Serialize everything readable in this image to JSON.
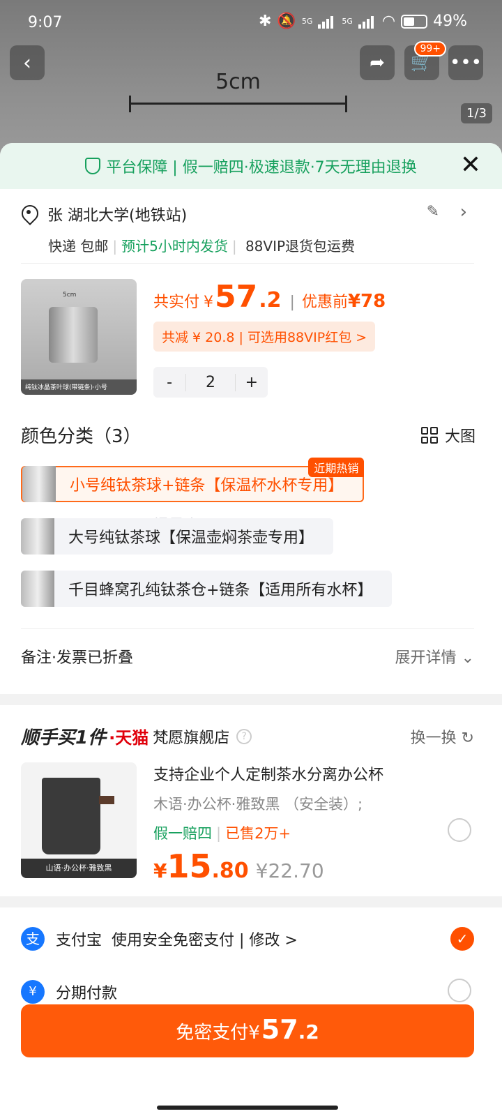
{
  "status": {
    "time": "9:07",
    "net1": "5G",
    "net2": "5G",
    "battery": "49%"
  },
  "header": {
    "cart_badge": "99+",
    "pager": "1/3",
    "measure_label": "5cm"
  },
  "guarantee": {
    "text": "平台保障 | 假一赔四·极速退款·7天无理由退换"
  },
  "address": {
    "name_addr": "张 湖北大学(地铁站)",
    "delivery": "快递 包邮",
    "ship_eta": "预计5小时内发货",
    "vip_return": "88VIP退货包运费"
  },
  "product": {
    "thumb_dim": "5cm",
    "thumb_caption": "纯钛冰晶茶叶球(带链条)·小号",
    "price_prefix": "共实付",
    "currency": "¥",
    "price_int": "57",
    "price_dec": ".2",
    "before_label": "优惠前",
    "before_price": "¥78",
    "saving": "共减 ¥ 20.8 | 可选用88VIP红包 >",
    "qty_minus": "-",
    "qty": "2",
    "qty_plus": "+"
  },
  "variants": {
    "title": "颜色分类（3）",
    "big_pic": "大图",
    "hot_tag": "近期热销",
    "items": [
      {
        "label": "小号纯钛茶球+链条【保温杯水杯专用】",
        "selected": true
      },
      {
        "label": "大号纯钛茶球【保温壶焖茶壶专用】",
        "selected": false
      },
      {
        "label": "千目蜂窝孔纯钛茶仓+链条【适用所有水杯】",
        "selected": false
      }
    ],
    "watermark": "慢是人720544455N"
  },
  "notes": {
    "label": "备注·发票已折叠",
    "expand": "展开详情"
  },
  "shunshou": {
    "brand": "顺手买1件",
    "tmall": "·天猫",
    "store": "梵愿旗舰店",
    "help": "?",
    "swap": "换一换 ↻"
  },
  "rec": {
    "img_caption": "山语·办公杯·雅致黑",
    "title": "支持企业个人定制茶水分离办公杯",
    "sku": "木语·办公杯·雅致黑 （安全装）;",
    "guarantee": "假一赔四",
    "sold": "已售2万+",
    "currency": "¥",
    "price_int": "15",
    "price_dec": ".80",
    "orig": "¥22.70"
  },
  "payment": {
    "alipay": "支付宝",
    "alipay_sub": "使用安全免密支付 | 修改 >",
    "fenqi": "分期付款"
  },
  "pay_button": {
    "label": "免密支付",
    "currency": "¥",
    "amount_int": "57",
    "amount_dec": ".2"
  },
  "colors": {
    "accent": "#ff5000",
    "green": "#16a05d",
    "alipay_blue": "#1677ff"
  }
}
